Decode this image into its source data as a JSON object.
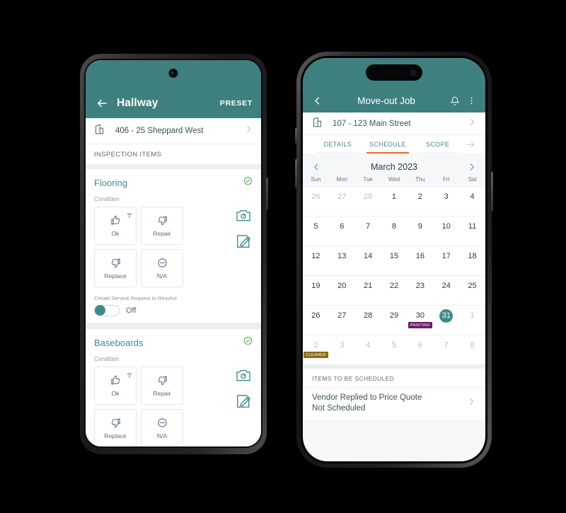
{
  "android": {
    "appbar": {
      "back_icon": "arrow-left-icon",
      "title": "Hallway",
      "action_label": "PRESET"
    },
    "property": {
      "icon": "building-icon",
      "label": "406 - 25 Sheppard West",
      "chevron": "chevron-right-icon"
    },
    "section_label": "INSPECTION ITEMS",
    "items": [
      {
        "title": "Flooring",
        "status_icon": "check-circle-icon",
        "condition_label": "Condition",
        "choices": [
          {
            "label": "Ok",
            "icon": "thumbs-up-icon",
            "pin": true
          },
          {
            "label": "Repair",
            "icon": "thumbs-down-icon",
            "pin": false
          },
          {
            "label": "Replace",
            "icon": "thumbs-down-icon",
            "pin": false
          },
          {
            "label": "N/A",
            "icon": "minus-circle-icon",
            "pin": false
          }
        ],
        "side_icons": [
          "camera-icon",
          "edit-note-icon"
        ],
        "service_request_label": "Create Service Request to Resolve",
        "toggle_value": "Off"
      },
      {
        "title": "Baseboards",
        "status_icon": "check-circle-icon",
        "condition_label": "Condition",
        "choices": [
          {
            "label": "Ok",
            "icon": "thumbs-up-icon",
            "pin": true
          },
          {
            "label": "Repair",
            "icon": "thumbs-down-icon",
            "pin": false
          },
          {
            "label": "Replace",
            "icon": "thumbs-down-icon",
            "pin": false
          },
          {
            "label": "N/A",
            "icon": "minus-circle-icon",
            "pin": false
          }
        ],
        "side_icons": [
          "camera-icon",
          "edit-note-icon"
        ]
      }
    ]
  },
  "ios": {
    "appbar": {
      "back_icon": "chevron-left-icon",
      "title": "Move-out Job",
      "bell_icon": "bell-icon",
      "overflow_icon": "more-vertical-icon"
    },
    "property": {
      "icon": "building-icon",
      "label": "107 - 123 Main Street",
      "chevron": "chevron-right-icon"
    },
    "tabs": [
      {
        "label": "DETAILS",
        "active": false
      },
      {
        "label": "SCHEDULE",
        "active": true
      },
      {
        "label": "SCOPE",
        "active": false
      }
    ],
    "tabs_overflow_icon": "arrow-right-icon",
    "calendar": {
      "prev_icon": "chevron-left-icon",
      "next_icon": "chevron-right-icon",
      "title": "March 2023",
      "weekdays": [
        "Sun",
        "Mon",
        "Tue",
        "Wed",
        "Thu",
        "Fri",
        "Sat"
      ],
      "days": [
        {
          "n": "26",
          "muted": true
        },
        {
          "n": "27",
          "muted": true
        },
        {
          "n": "28",
          "muted": true
        },
        {
          "n": "1",
          "muted": false
        },
        {
          "n": "2",
          "muted": false
        },
        {
          "n": "3",
          "muted": false
        },
        {
          "n": "4",
          "muted": false
        },
        {
          "n": "5",
          "muted": false
        },
        {
          "n": "6",
          "muted": false
        },
        {
          "n": "7",
          "muted": false
        },
        {
          "n": "8",
          "muted": false
        },
        {
          "n": "9",
          "muted": false
        },
        {
          "n": "10",
          "muted": false
        },
        {
          "n": "11",
          "muted": false
        },
        {
          "n": "12",
          "muted": false
        },
        {
          "n": "13",
          "muted": false
        },
        {
          "n": "14",
          "muted": false
        },
        {
          "n": "15",
          "muted": false
        },
        {
          "n": "16",
          "muted": false
        },
        {
          "n": "17",
          "muted": false
        },
        {
          "n": "18",
          "muted": false
        },
        {
          "n": "19",
          "muted": false
        },
        {
          "n": "20",
          "muted": false
        },
        {
          "n": "21",
          "muted": false
        },
        {
          "n": "22",
          "muted": false
        },
        {
          "n": "23",
          "muted": false
        },
        {
          "n": "24",
          "muted": false
        },
        {
          "n": "25",
          "muted": false
        },
        {
          "n": "26",
          "muted": false
        },
        {
          "n": "27",
          "muted": false
        },
        {
          "n": "28",
          "muted": false
        },
        {
          "n": "29",
          "muted": false
        },
        {
          "n": "30",
          "muted": false,
          "badge": "PAINTING",
          "badge_color": "#6b1a66"
        },
        {
          "n": "31",
          "muted": false,
          "selected": true
        },
        {
          "n": "1",
          "muted": true
        },
        {
          "n": "2",
          "muted": true,
          "badge": "CLEANER",
          "badge_color": "#8a6a16"
        },
        {
          "n": "3",
          "muted": true
        },
        {
          "n": "4",
          "muted": true
        },
        {
          "n": "5",
          "muted": true
        },
        {
          "n": "6",
          "muted": true
        },
        {
          "n": "7",
          "muted": true
        },
        {
          "n": "8",
          "muted": true
        }
      ]
    },
    "schedule": {
      "header": "ITEMS TO BE SCHEDULED",
      "items": [
        {
          "line1": "Vendor Replied to Price Quote",
          "line2": "Not Scheduled",
          "chevron": "chevron-right-icon"
        }
      ]
    }
  },
  "colors": {
    "teal_header": "#3d807e",
    "teal_accent": "#3d8c8a",
    "orange_tab": "#ea6a2c",
    "green_check": "#4cae4f",
    "badge_painting": "#6b1a66",
    "badge_cleaner": "#8a6a16",
    "page_bg": "#000000"
  }
}
